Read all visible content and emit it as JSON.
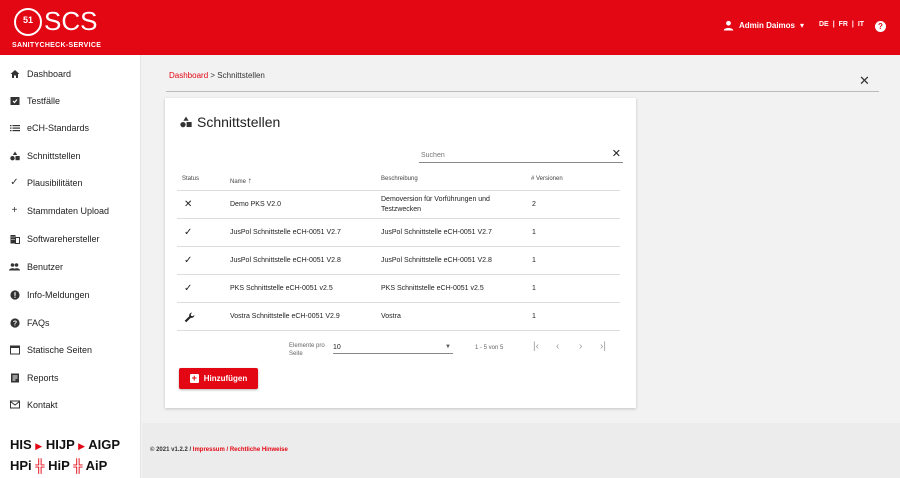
{
  "header": {
    "logo_number": "51",
    "logo_text": "SCS",
    "logo_subtitle": "SANITYCHECK-SERVICE",
    "user_name": "Admin Daimos",
    "user_caret": "▾",
    "languages": [
      "DE",
      "FR",
      "IT"
    ],
    "lang_sep": "|",
    "help": "?"
  },
  "sidebar": {
    "items": [
      {
        "label": "Dashboard",
        "icon": "home-icon"
      },
      {
        "label": "Testfälle",
        "icon": "test-case-icon"
      },
      {
        "label": "eCH-Standards",
        "icon": "list-icon"
      },
      {
        "label": "Schnittstellen",
        "icon": "interfaces-icon"
      },
      {
        "label": "Plausibilitäten",
        "icon": "check-icon"
      },
      {
        "label": "Stammdaten Upload",
        "icon": "plus-icon"
      },
      {
        "label": "Softwarehersteller",
        "icon": "building-icon"
      },
      {
        "label": "Benutzer",
        "icon": "users-icon"
      },
      {
        "label": "Info-Meldungen",
        "icon": "alert-icon"
      },
      {
        "label": "FAQs",
        "icon": "help-icon"
      },
      {
        "label": "Statische Seiten",
        "icon": "browser-icon"
      },
      {
        "label": "Reports",
        "icon": "report-icon"
      },
      {
        "label": "Kontakt",
        "icon": "mail-icon"
      }
    ],
    "brand_row1": [
      "HIS",
      "HIJP",
      "AIGP"
    ],
    "brand_row2": [
      "HPi",
      "HiP",
      "AiP"
    ]
  },
  "breadcrumb": {
    "link": "Dashboard",
    "sep": ">",
    "current": "Schnittstellen"
  },
  "card": {
    "title": "Schnittstellen",
    "search_placeholder": "Suchen",
    "columns": {
      "status": "Status",
      "name": "Name",
      "sort_arrow": "↑",
      "description": "Beschreibung",
      "versions": "# Versionen"
    },
    "rows": [
      {
        "status": "✕",
        "status_icon": "close-icon",
        "name": "Demo PKS V2.0",
        "description": "Demoversion für Vorführungen und Testzwecken",
        "versions": "2"
      },
      {
        "status": "✓",
        "status_icon": "check-icon",
        "name": "JusPol Schnittstelle eCH-0051 V2.7",
        "description": "JusPol Schnittstelle eCH-0051 V2.7",
        "versions": "1"
      },
      {
        "status": "✓",
        "status_icon": "check-icon",
        "name": "JusPol Schnittstelle eCH-0051 V2.8",
        "description": "JusPol Schnittstelle eCH-0051 V2.8",
        "versions": "1"
      },
      {
        "status": "✓",
        "status_icon": "check-icon",
        "name": "PKS Schnittstelle eCH-0051 v2.5",
        "description": "PKS Schnittstelle eCH-0051 v2.5",
        "versions": "1"
      },
      {
        "status": "🔧",
        "status_icon": "wrench-icon",
        "name": "Vostra Schnittstelle eCH-0051 V2.9",
        "description": "Vostra",
        "versions": "1"
      }
    ],
    "pager": {
      "per_page_label": "Elemente pro Seite",
      "per_page_value": "10",
      "range": "1 - 5 von 5",
      "first": "|‹",
      "prev": "‹",
      "next": "›",
      "last": "›|"
    },
    "add_button": "Hinzufügen"
  },
  "footer": {
    "version": "© 2021 v1.2.2 /",
    "impressum": "Impressum",
    "sep": "/",
    "legal": "Rechtliche Hinweise"
  },
  "colors": {
    "brand_red": "#e30613"
  }
}
